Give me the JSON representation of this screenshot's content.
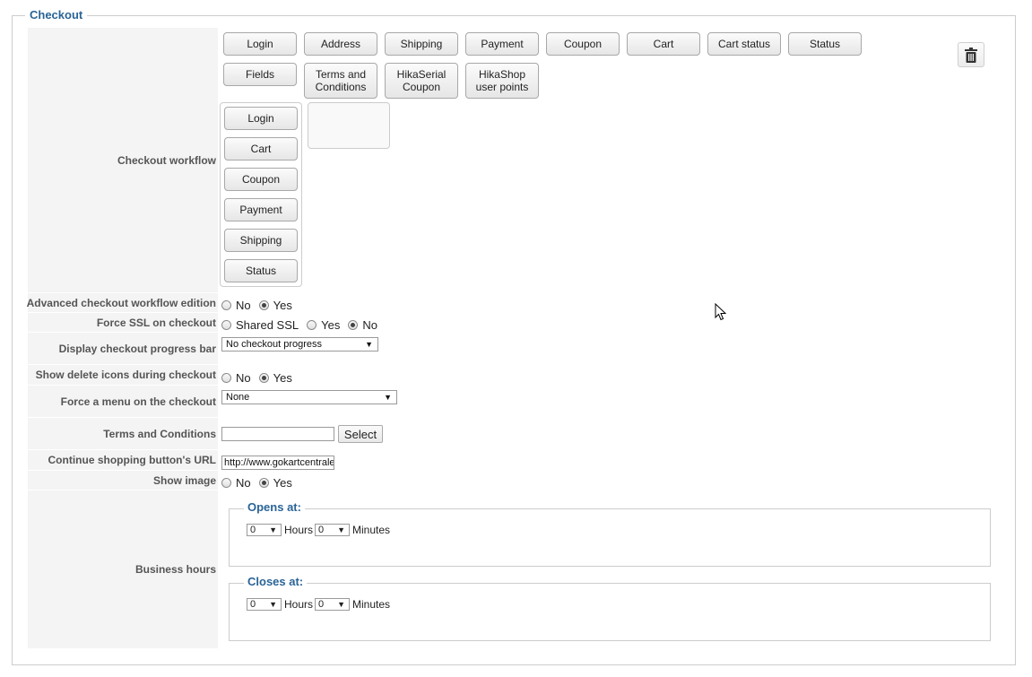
{
  "legend": "Checkout",
  "labels": {
    "workflow": "Checkout workflow",
    "advanced": "Advanced checkout workflow edition",
    "ssl": "Force SSL on checkout",
    "progress": "Display checkout progress bar",
    "delete_icons": "Show delete icons during checkout",
    "menu": "Force a menu on the checkout",
    "terms": "Terms and Conditions",
    "continue_url": "Continue shopping button's URL",
    "show_image": "Show image",
    "business_hours": "Business hours"
  },
  "workflow_buttons": {
    "b0": "Login",
    "b1": "Address",
    "b2": "Shipping",
    "b3": "Payment",
    "b4": "Coupon",
    "b5": "Cart",
    "b6": "Cart status",
    "b7": "Status",
    "b8": "Fields",
    "b9": "Terms and\nConditions",
    "b10": "HikaSerial\nCoupon",
    "b11": "HikaShop\nuser points"
  },
  "workflow_steps": {
    "s0": "Login",
    "s1": "Cart",
    "s2": "Coupon",
    "s3": "Payment",
    "s4": "Shipping",
    "s5": "Status"
  },
  "advanced": {
    "options": [
      "No",
      "Yes"
    ],
    "selected": "Yes"
  },
  "ssl": {
    "options": [
      "Shared SSL",
      "Yes",
      "No"
    ],
    "selected": "No"
  },
  "progress": {
    "value": "No checkout progress"
  },
  "delete_icons": {
    "options": [
      "No",
      "Yes"
    ],
    "selected": "Yes"
  },
  "menu": {
    "value": "None"
  },
  "terms": {
    "value": "",
    "select_label": "Select"
  },
  "continue_url": {
    "value": "http://www.gokartcentralei"
  },
  "show_image": {
    "options": [
      "No",
      "Yes"
    ],
    "selected": "Yes"
  },
  "business_hours": {
    "opens": {
      "legend": "Opens at:",
      "hours": "0",
      "hours_label": "Hours",
      "minutes": "0",
      "minutes_label": "Minutes"
    },
    "closes": {
      "legend": "Closes at:",
      "hours": "0",
      "hours_label": "Hours",
      "minutes": "0",
      "minutes_label": "Minutes"
    }
  },
  "icons": {
    "trash": "trash-icon",
    "cursor": "mouse-pointer-icon"
  },
  "colors": {
    "legend": "#2a6496",
    "label_bg": "#f4f4f4"
  }
}
